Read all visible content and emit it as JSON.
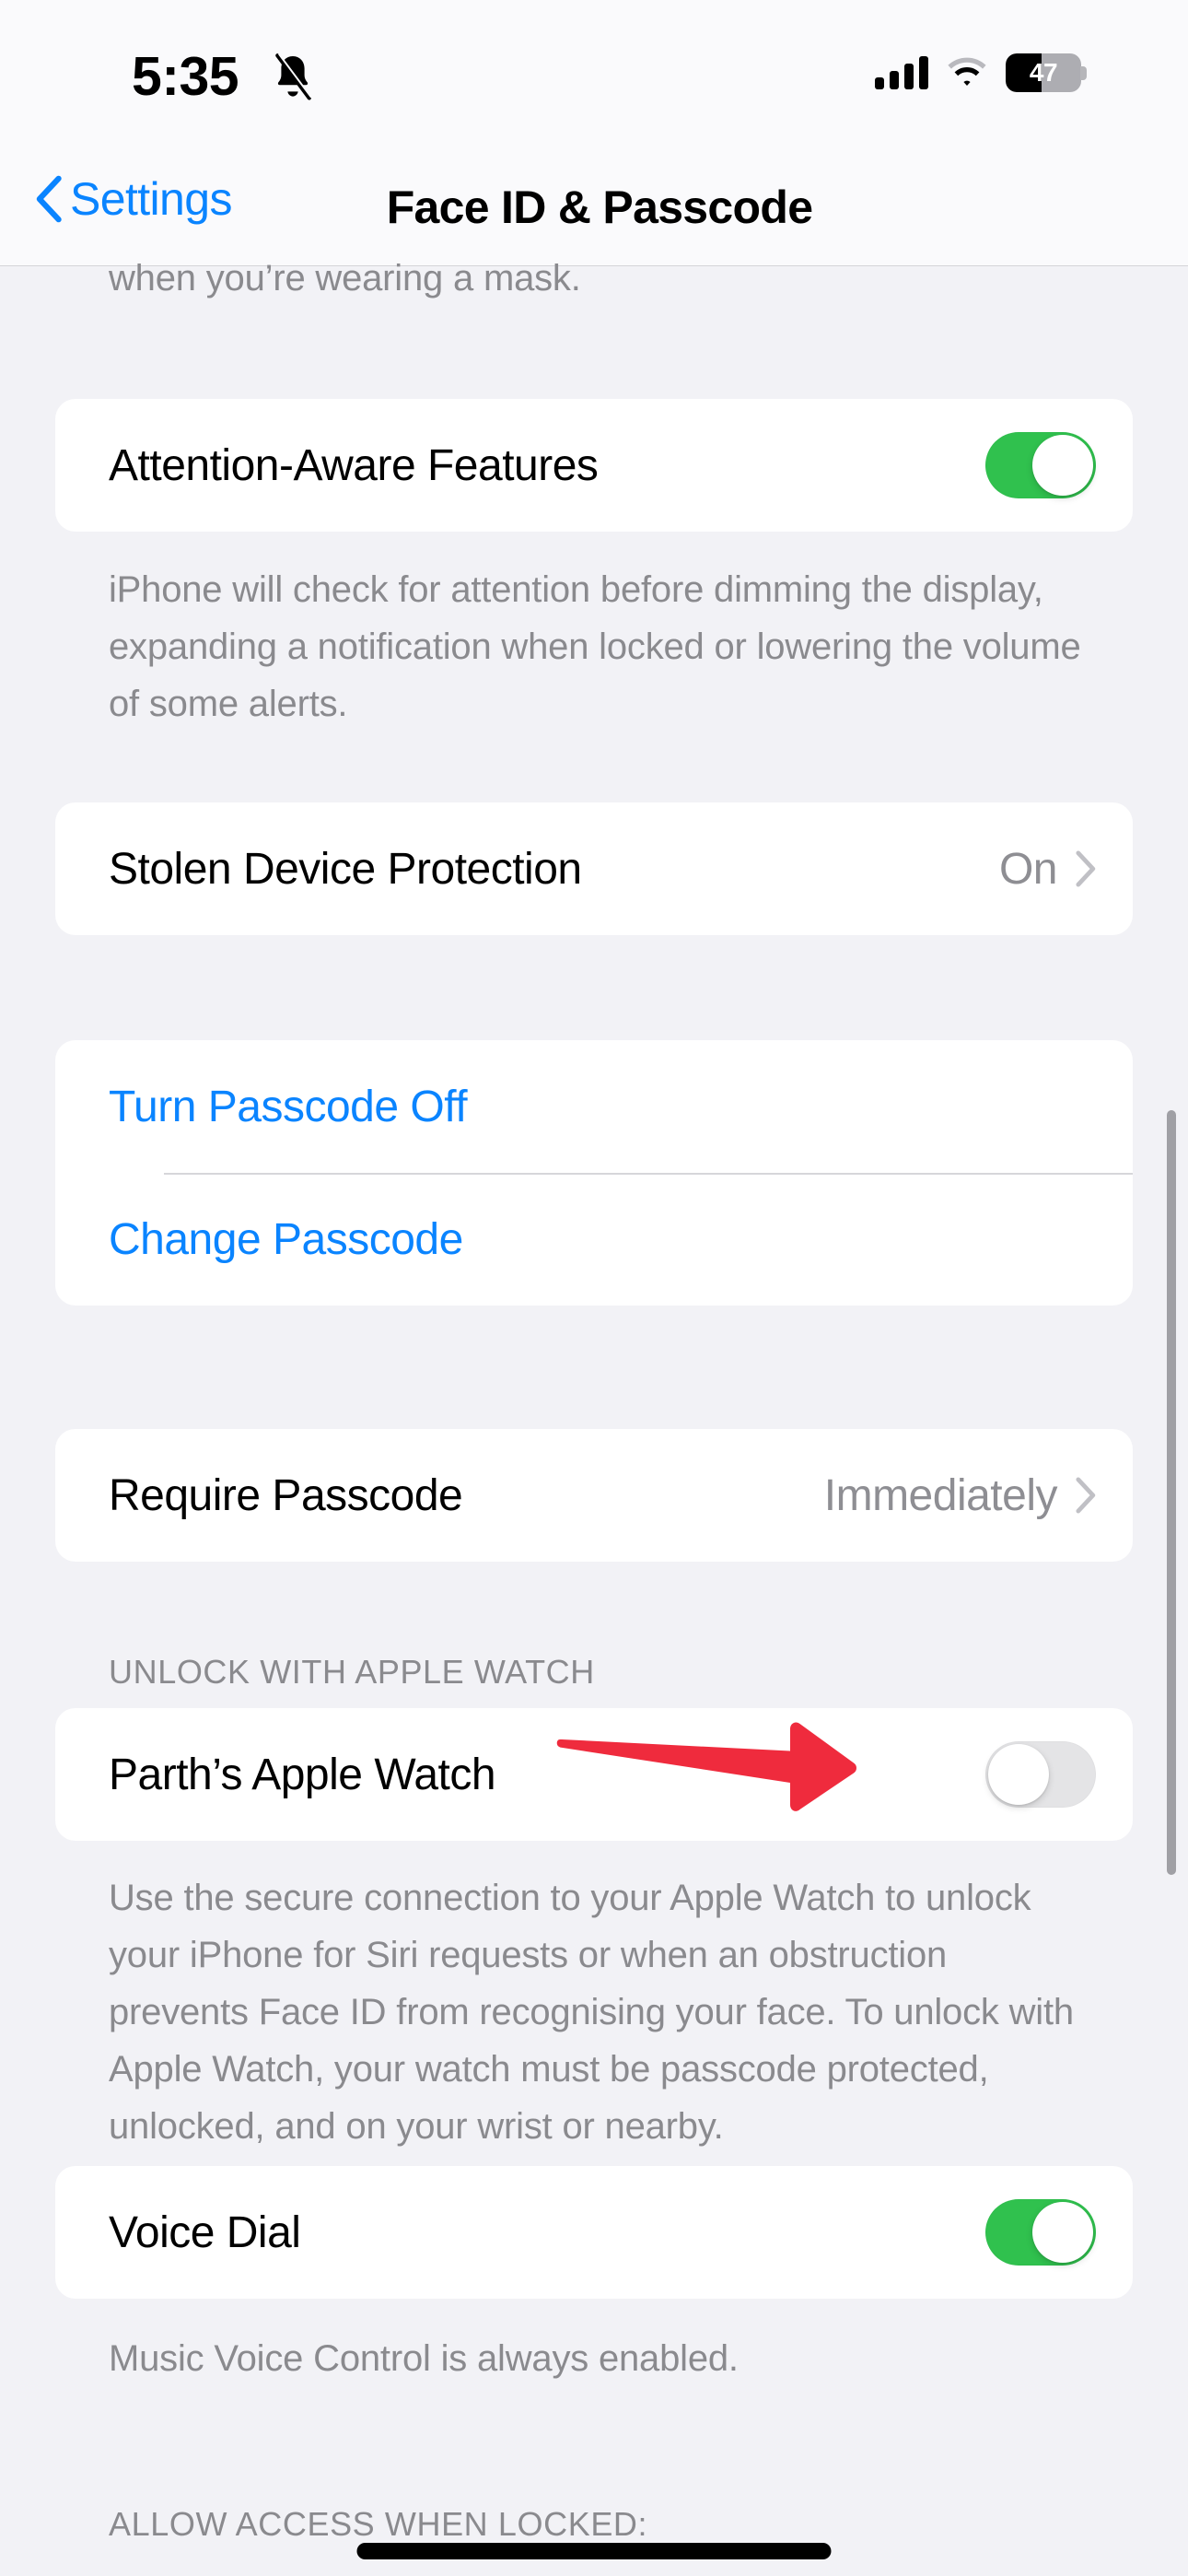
{
  "status_bar": {
    "time": "5:35",
    "silent_icon": "bell-slash-icon",
    "cellular_icon": "signal-bars-icon",
    "wifi_icon": "wifi-icon",
    "battery_percent": "47",
    "battery_level": 47
  },
  "nav": {
    "back_label": "Settings",
    "title": "Face ID & Passcode"
  },
  "content": {
    "mask_footnote_partial": "when you’re wearing a mask.",
    "attention": {
      "label": "Attention-Aware Features",
      "toggle_state": "on",
      "footnote": "iPhone will check for attention before dimming the display, expanding a notification when locked or lowering the volume of some alerts."
    },
    "stolen_device": {
      "label": "Stolen Device Protection",
      "value": "On"
    },
    "passcode_actions": [
      {
        "label": "Turn Passcode Off"
      },
      {
        "label": "Change Passcode"
      }
    ],
    "require_passcode": {
      "label": "Require Passcode",
      "value": "Immediately"
    },
    "apple_watch": {
      "section_header": "UNLOCK WITH APPLE WATCH",
      "label": "Parth’s Apple Watch",
      "toggle_state": "off",
      "footnote": "Use the secure connection to your Apple Watch to unlock your iPhone for Siri requests or when an obstruction prevents Face ID from recognising your face. To unlock with Apple Watch, your watch must be passcode protected, unlocked, and on your wrist or nearby."
    },
    "voice_dial": {
      "label": "Voice Dial",
      "toggle_state": "on",
      "footnote": "Music Voice Control is always enabled."
    },
    "allow_access_header": "ALLOW ACCESS WHEN LOCKED:"
  },
  "annotation": {
    "arrow_color": "#ef2b3d",
    "arrow_target": "apple-watch-toggle"
  },
  "colors": {
    "accent_blue": "#0a84ff",
    "toggle_on_green": "#30c14e",
    "toggle_off_gray": "#e4e4e6",
    "background": "#f2f2f6",
    "card": "#ffffff",
    "secondary_text": "#8a8a8e"
  }
}
